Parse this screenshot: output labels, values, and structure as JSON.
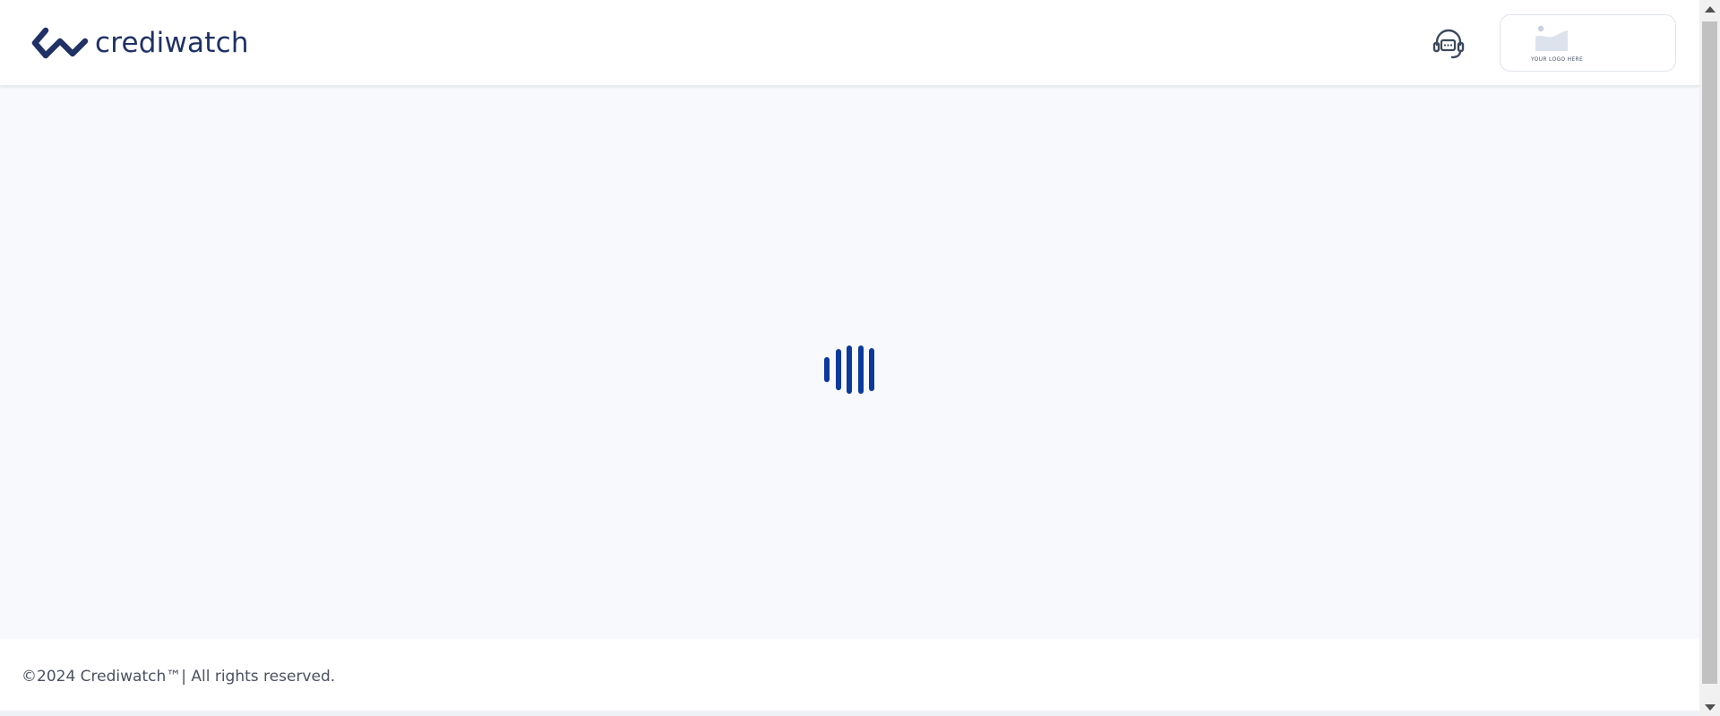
{
  "header": {
    "brand_name": "crediwatch",
    "brand_color": "#1f3166",
    "support_icon": "headset-chat-icon",
    "logo_placeholder": {
      "icon": "image-placeholder-icon",
      "caption": "YOUR LOGO HERE"
    }
  },
  "main": {
    "loader_icon": "loading-bars-icon",
    "loader_color": "#0b3a9c",
    "background_color": "#f7f9fc"
  },
  "footer": {
    "copyright": "©2024 Crediwatch™| All rights reserved."
  }
}
